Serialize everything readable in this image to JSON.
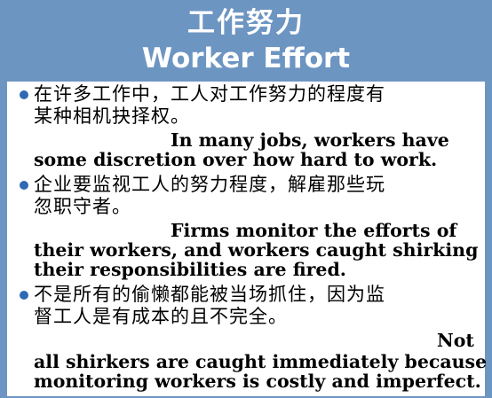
{
  "title": {
    "chinese": "工作努力",
    "english": "Worker Effort"
  },
  "bullets": [
    {
      "chinese_line1": "在许多工作中，工人对工作努力的程度有",
      "chinese_line2": "某种相机抉择权。",
      "english_line1": "In many jobs, workers have",
      "english_line2": "some discretion over how hard to work."
    },
    {
      "chinese_line1": "企业要监视工人的努力程度，解雇那些玩",
      "chinese_line2": "忽职守者。",
      "english_line1": "Firms monitor the efforts of",
      "english_line2": "their workers, and workers caught shirking",
      "english_line3": "their responsibilities are fired."
    },
    {
      "chinese_line1": "不是所有的偷懒都能被当场抓住，因为监",
      "chinese_line2": "督工人是有成本的且不完全。",
      "english_line1": "Not",
      "english_line2": "all shirkers are caught immediately because",
      "english_line3": "monitoring workers is costly and imperfect."
    }
  ],
  "colors": {
    "background": "#6d95c2",
    "bullet": "#2e6ab3",
    "panel": "#ffffff"
  }
}
